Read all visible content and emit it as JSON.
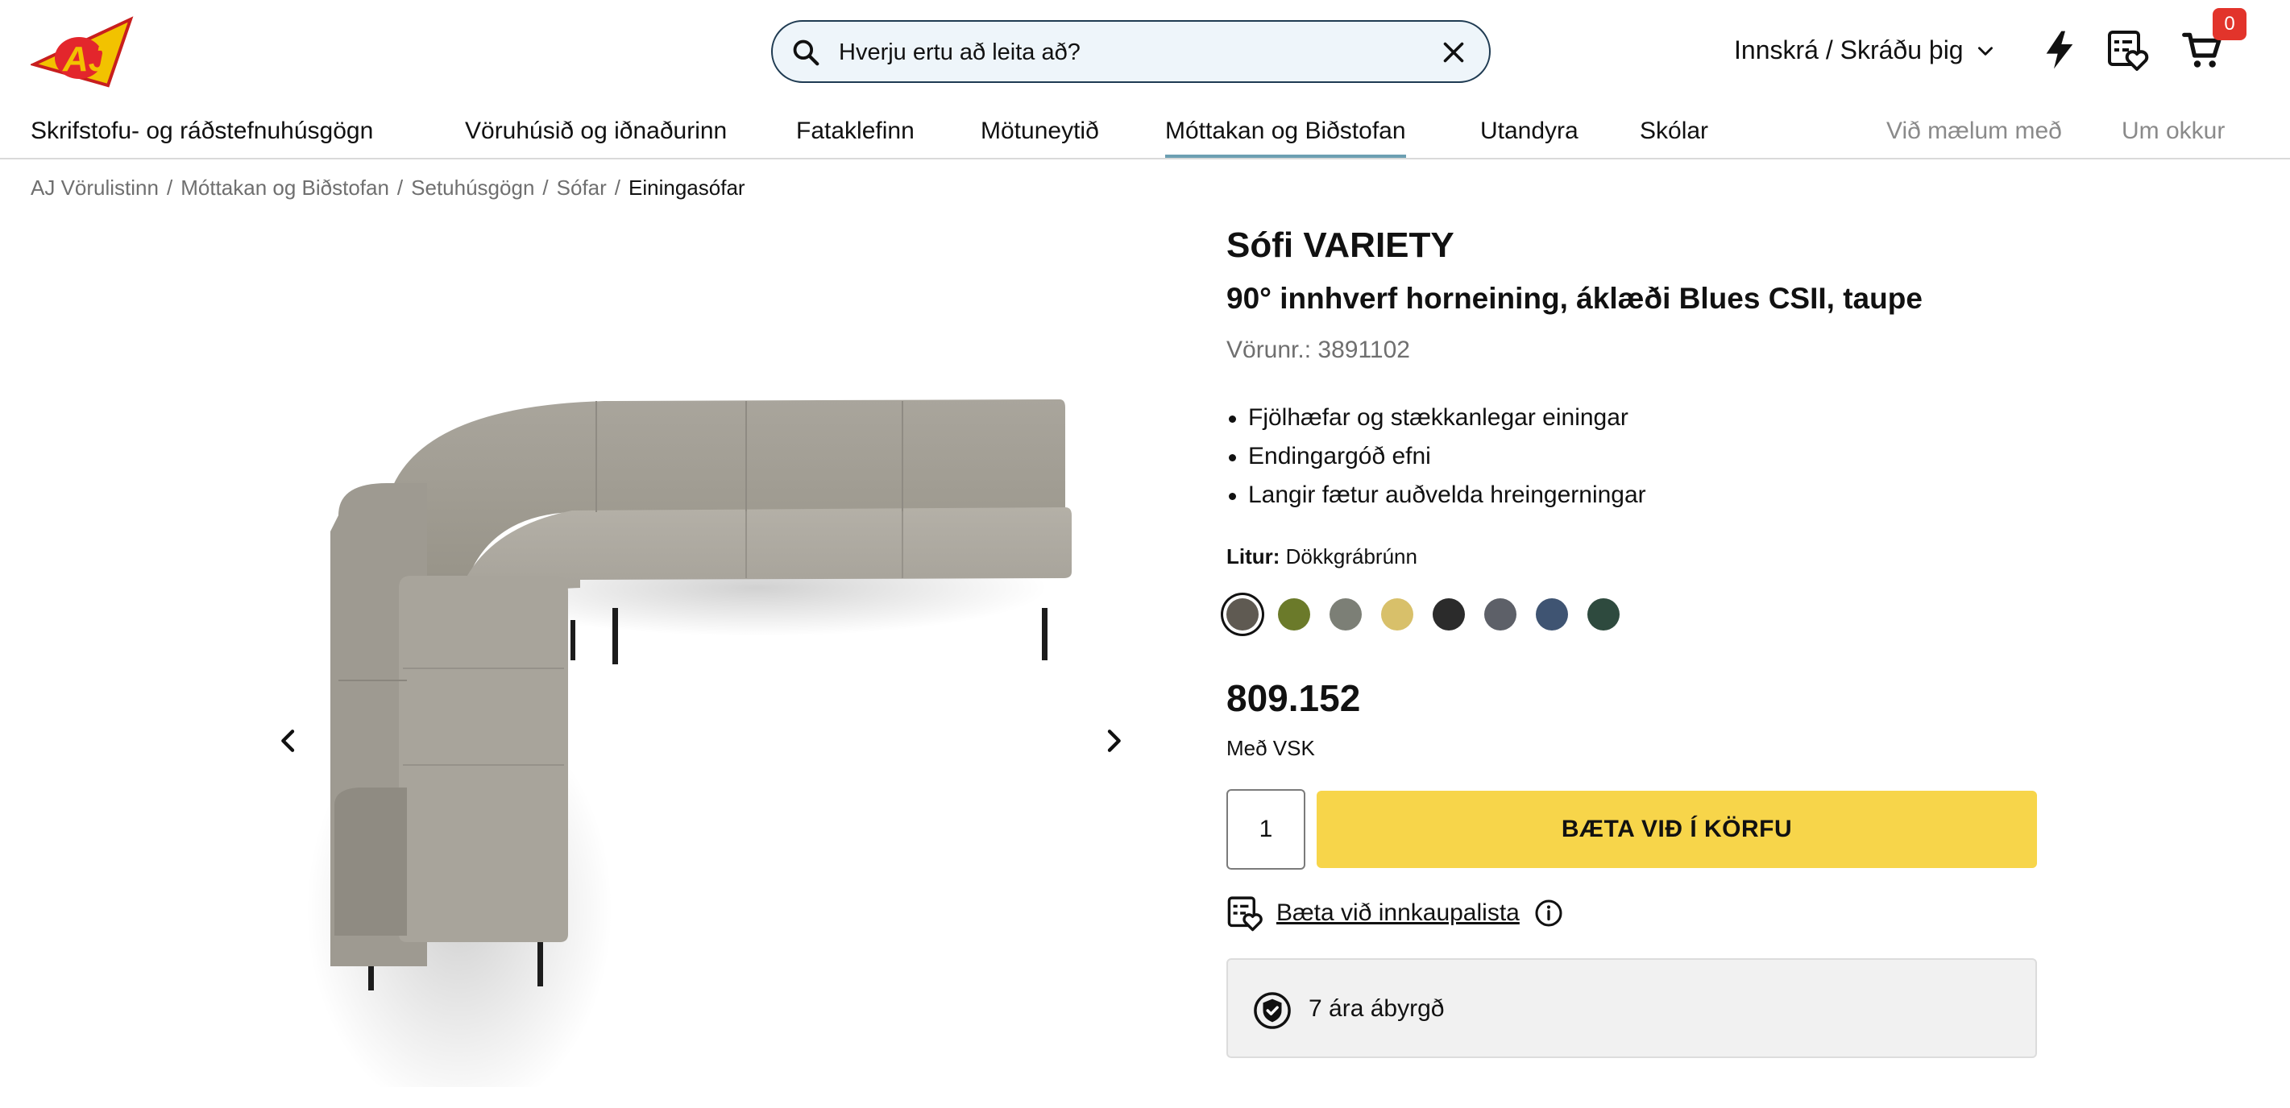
{
  "header": {
    "search_placeholder": "Hverju ertu að leita að?",
    "login_label": "Innskrá / Skráðu þig",
    "cart_count": "0"
  },
  "nav": {
    "items": [
      "Skrifstofu- og ráðstefnuhúsgögn",
      "Vöruhúsið og iðnaðurinn",
      "Fataklefinn",
      "Mötuneytið",
      "Móttakan og Biðstofan",
      "Utandyra",
      "Skólar"
    ],
    "active_index": 4,
    "secondary": [
      "Við mælum með",
      "Um okkur"
    ]
  },
  "breadcrumb": [
    "AJ Vörulistinn",
    "Móttakan og Biðstofan",
    "Setuhúsgögn",
    "Sófar",
    "Einingasófar"
  ],
  "product": {
    "title": "Sófi VARIETY",
    "subtitle": "90° innhverf horneining, áklæði Blues CSII, taupe",
    "sku": "Vörunr.: 3891102",
    "bullets": [
      "Fjölhæfar og stækkanlegar einingar",
      "Endingargóð efni",
      "Langir fætur auðvelda hreingerningar"
    ],
    "color_label": "Litur:",
    "color_value": "Dökkgrábrúnn",
    "swatches": [
      "#5f5a52",
      "#6b7a2a",
      "#7c7f76",
      "#d8c06a",
      "#2b2b2b",
      "#5d6068",
      "#3f5472",
      "#2e4a3e"
    ],
    "selected_swatch": 0,
    "price": "809.152",
    "vat_label": "Með VSK",
    "quantity": "1",
    "add_to_cart": "BÆTA VIÐ Í KÖRFU",
    "wishlist_label": "Bæta við innkaupalista",
    "warranty": "7 ára ábyrgð"
  },
  "colors": {
    "accent_yellow": "#f7d54a",
    "nav_underline": "#6c9fb2",
    "badge_red": "#e2342b",
    "search_border": "#1f3b52"
  }
}
